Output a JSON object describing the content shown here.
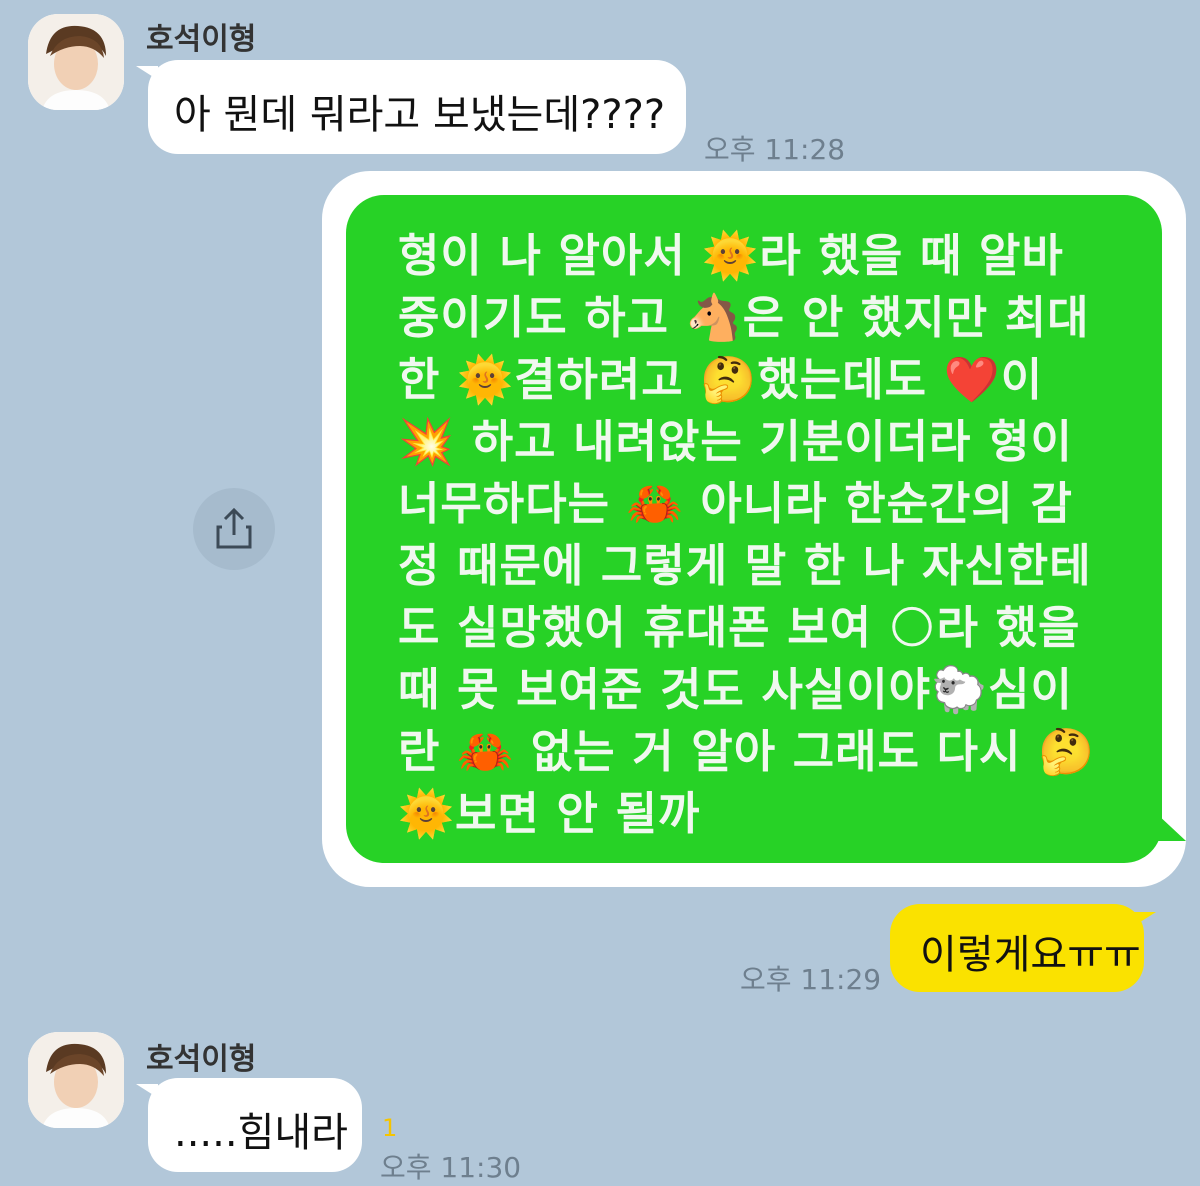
{
  "messages": {
    "first": {
      "sender": "호석이형",
      "text": "아 뭔데 뭐라고 보냈는데????",
      "time": "오후 11:28"
    },
    "image": {
      "lines": [
        "형이 나 알아서 🌞라 했을 때 알바",
        "중이기도 하고 🐴은 안 했지만 최대",
        "한 🌞결하려고 🤔했는데도 ❤️이",
        "💥 하고 내려앉는 기분이더라 형이",
        "너무하다는 🦀 아니라 한순간의 감",
        "정 때문에 그렇게 말 한 나 자신한테",
        "도 실망했어 휴대폰 보여 🌕라 했을",
        "때 못 보여준 것도 사실이야🐑심이",
        "란 🦀 없는 거 알아 그래도 다시 🤔",
        "🌞보면 안 될까"
      ]
    },
    "reply": {
      "text": "이렇게요ㅠㅠ",
      "time": "오후 11:29"
    },
    "last": {
      "sender": "호석이형",
      "text": ".....힘내라",
      "unread": "1",
      "time": "오후 11:30"
    }
  },
  "icons": {
    "share": "share-icon",
    "avatar": "profile-avatar"
  },
  "colors": {
    "background": "#b2c7d9",
    "my_bubble": "#fae200",
    "their_bubble": "#ffffff",
    "image_green": "#27d226"
  }
}
